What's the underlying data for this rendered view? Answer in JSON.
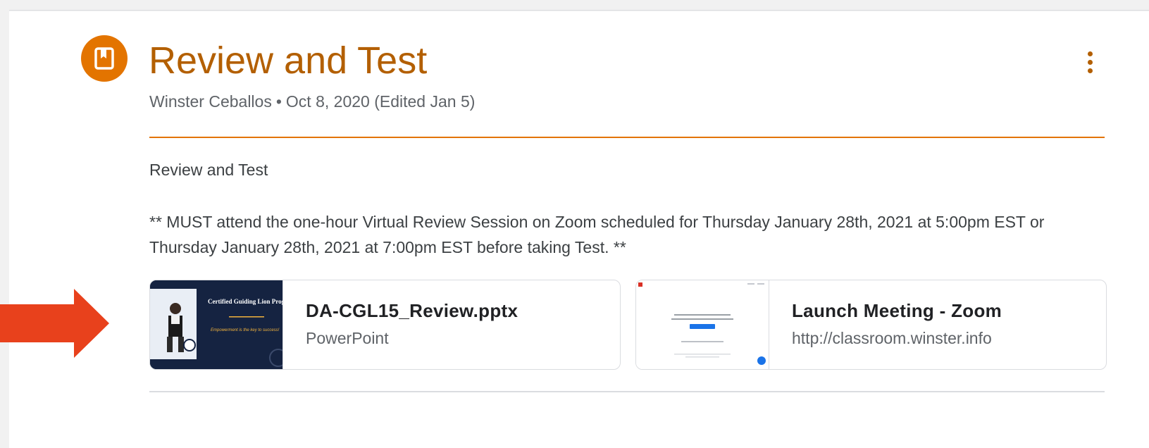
{
  "post": {
    "title": "Review and Test",
    "author": "Winster Ceballos",
    "separator": "•",
    "date": "Oct 8, 2020 (Edited Jan 5)"
  },
  "description": {
    "line1": "Review and Test",
    "line2": "** MUST attend the one-hour Virtual Review Session on Zoom scheduled for Thursday January 28th, 2021 at 5:00pm EST or Thursday January 28th, 2021 at 7:00pm EST before taking Test. **"
  },
  "attachments": [
    {
      "title": "DA-CGL15_Review.pptx",
      "subtitle": "PowerPoint",
      "icon": "slide-thumbnail"
    },
    {
      "title": "Launch Meeting - Zoom",
      "subtitle": "http://classroom.winster.info",
      "icon": "web-page-thumbnail"
    }
  ],
  "thumbnail_text": {
    "ppt_title": "Certified Guiding Lion Progr",
    "ppt_tagline": "Empowerment is the key to success!"
  },
  "colors": {
    "accent": "#e37400",
    "title": "#b35f00",
    "arrow": "#e8411c"
  },
  "icons": {
    "post_type": "bookmark-icon",
    "more": "more-vert-icon",
    "callout": "right-arrow-icon"
  }
}
